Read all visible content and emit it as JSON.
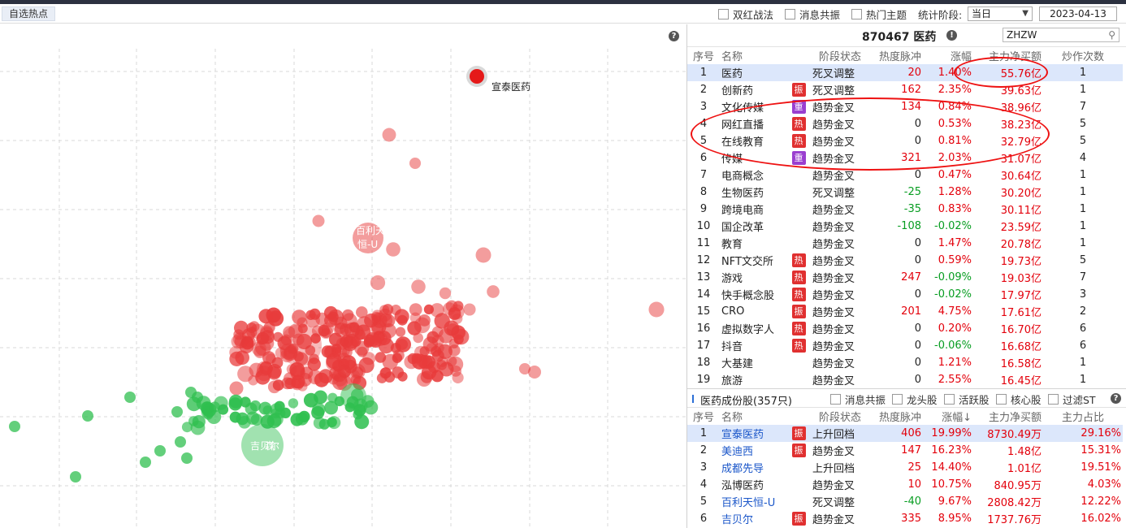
{
  "toolbar": {
    "tab_label": "自选热点",
    "checks": [
      "双红战法",
      "消息共振",
      "热门主题"
    ],
    "stat_label": "统计阶段:",
    "period": "当日",
    "date": "2023-04-13"
  },
  "scatter": {
    "highlight_label": "宣泰医药",
    "labels": [
      "百利天",
      "恒-U",
      "吉贝尔",
      "森"
    ],
    "colors": {
      "up": "#e83b3b",
      "down": "#2fbf4f"
    }
  },
  "sector_panel": {
    "title": "870467 医药",
    "search_value": "ZHZW",
    "columns": [
      "序号",
      "名称",
      "阶段状态",
      "热度脉冲",
      "涨幅",
      "主力净买额",
      "炒作次数"
    ],
    "rows": [
      {
        "idx": "1",
        "name": "医药",
        "tag": "",
        "status": "死叉调整",
        "heat": "20",
        "chg": "1.40%",
        "net": "55.76亿",
        "times": "1"
      },
      {
        "idx": "2",
        "name": "创新药",
        "tag": "振",
        "status": "死叉调整",
        "heat": "162",
        "chg": "2.35%",
        "net": "39.63亿",
        "times": "1"
      },
      {
        "idx": "3",
        "name": "文化传媒",
        "tag": "重",
        "status": "趋势金叉",
        "heat": "134",
        "chg": "0.84%",
        "net": "38.96亿",
        "times": "7"
      },
      {
        "idx": "4",
        "name": "网红直播",
        "tag": "热",
        "status": "趋势金叉",
        "heat": "0",
        "chg": "0.53%",
        "net": "38.23亿",
        "times": "5"
      },
      {
        "idx": "5",
        "name": "在线教育",
        "tag": "热",
        "status": "趋势金叉",
        "heat": "0",
        "chg": "0.81%",
        "net": "32.79亿",
        "times": "5"
      },
      {
        "idx": "6",
        "name": "传媒",
        "tag": "重",
        "status": "趋势金叉",
        "heat": "321",
        "chg": "2.03%",
        "net": "31.07亿",
        "times": "4"
      },
      {
        "idx": "7",
        "name": "电商概念",
        "tag": "",
        "status": "趋势金叉",
        "heat": "0",
        "chg": "0.47%",
        "net": "30.64亿",
        "times": "1"
      },
      {
        "idx": "8",
        "name": "生物医药",
        "tag": "",
        "status": "死叉调整",
        "heat": "-25",
        "chg": "1.28%",
        "net": "30.20亿",
        "times": "1"
      },
      {
        "idx": "9",
        "name": "跨境电商",
        "tag": "",
        "status": "趋势金叉",
        "heat": "-35",
        "chg": "0.83%",
        "net": "30.11亿",
        "times": "1"
      },
      {
        "idx": "10",
        "name": "国企改革",
        "tag": "",
        "status": "趋势金叉",
        "heat": "-108",
        "chg": "-0.02%",
        "net": "23.59亿",
        "times": "1"
      },
      {
        "idx": "11",
        "name": "教育",
        "tag": "",
        "status": "趋势金叉",
        "heat": "0",
        "chg": "1.47%",
        "net": "20.78亿",
        "times": "1"
      },
      {
        "idx": "12",
        "name": "NFT文交所",
        "tag": "热",
        "status": "趋势金叉",
        "heat": "0",
        "chg": "0.59%",
        "net": "19.73亿",
        "times": "5"
      },
      {
        "idx": "13",
        "name": "游戏",
        "tag": "热",
        "status": "趋势金叉",
        "heat": "247",
        "chg": "-0.09%",
        "net": "19.03亿",
        "times": "7"
      },
      {
        "idx": "14",
        "name": "快手概念股",
        "tag": "热",
        "status": "趋势金叉",
        "heat": "0",
        "chg": "-0.02%",
        "net": "17.97亿",
        "times": "3"
      },
      {
        "idx": "15",
        "name": "CRO",
        "tag": "振",
        "status": "趋势金叉",
        "heat": "201",
        "chg": "4.75%",
        "net": "17.61亿",
        "times": "2"
      },
      {
        "idx": "16",
        "name": "虚拟数字人",
        "tag": "热",
        "status": "趋势金叉",
        "heat": "0",
        "chg": "0.20%",
        "net": "16.70亿",
        "times": "6"
      },
      {
        "idx": "17",
        "name": "抖音",
        "tag": "热",
        "status": "趋势金叉",
        "heat": "0",
        "chg": "-0.06%",
        "net": "16.68亿",
        "times": "6"
      },
      {
        "idx": "18",
        "name": "大基建",
        "tag": "",
        "status": "趋势金叉",
        "heat": "0",
        "chg": "1.21%",
        "net": "16.58亿",
        "times": "1"
      },
      {
        "idx": "19",
        "name": "旅游",
        "tag": "",
        "status": "趋势金叉",
        "heat": "0",
        "chg": "2.55%",
        "net": "16.45亿",
        "times": "1"
      }
    ]
  },
  "stock_panel": {
    "title": "医药成份股(357只)",
    "checks": [
      "消息共振",
      "龙头股",
      "活跃股",
      "核心股",
      "过滤ST"
    ],
    "columns": [
      "序号",
      "名称",
      "阶段状态",
      "热度脉冲",
      "涨幅↓",
      "主力净买额",
      "主力占比"
    ],
    "rows": [
      {
        "idx": "1",
        "name": "宣泰医药",
        "tag": "振",
        "status": "上升回档",
        "heat": "406",
        "chg": "19.99%",
        "net": "8730.49万",
        "ratio": "29.16%",
        "link": true
      },
      {
        "idx": "2",
        "name": "美迪西",
        "tag": "振",
        "status": "趋势金叉",
        "heat": "147",
        "chg": "16.23%",
        "net": "1.48亿",
        "ratio": "15.31%",
        "link": true
      },
      {
        "idx": "3",
        "name": "成都先导",
        "tag": "",
        "status": "上升回档",
        "heat": "25",
        "chg": "14.40%",
        "net": "1.01亿",
        "ratio": "19.51%",
        "link": true
      },
      {
        "idx": "4",
        "name": "泓博医药",
        "tag": "",
        "status": "趋势金叉",
        "heat": "10",
        "chg": "10.75%",
        "net": "840.95万",
        "ratio": "4.03%",
        "link": false
      },
      {
        "idx": "5",
        "name": "百利天恒-U",
        "tag": "",
        "status": "死叉调整",
        "heat": "-40",
        "chg": "9.67%",
        "net": "2808.42万",
        "ratio": "12.22%",
        "link": true
      },
      {
        "idx": "6",
        "name": "吉贝尔",
        "tag": "振",
        "status": "趋势金叉",
        "heat": "335",
        "chg": "8.95%",
        "net": "1737.76万",
        "ratio": "16.02%",
        "link": true
      }
    ]
  }
}
